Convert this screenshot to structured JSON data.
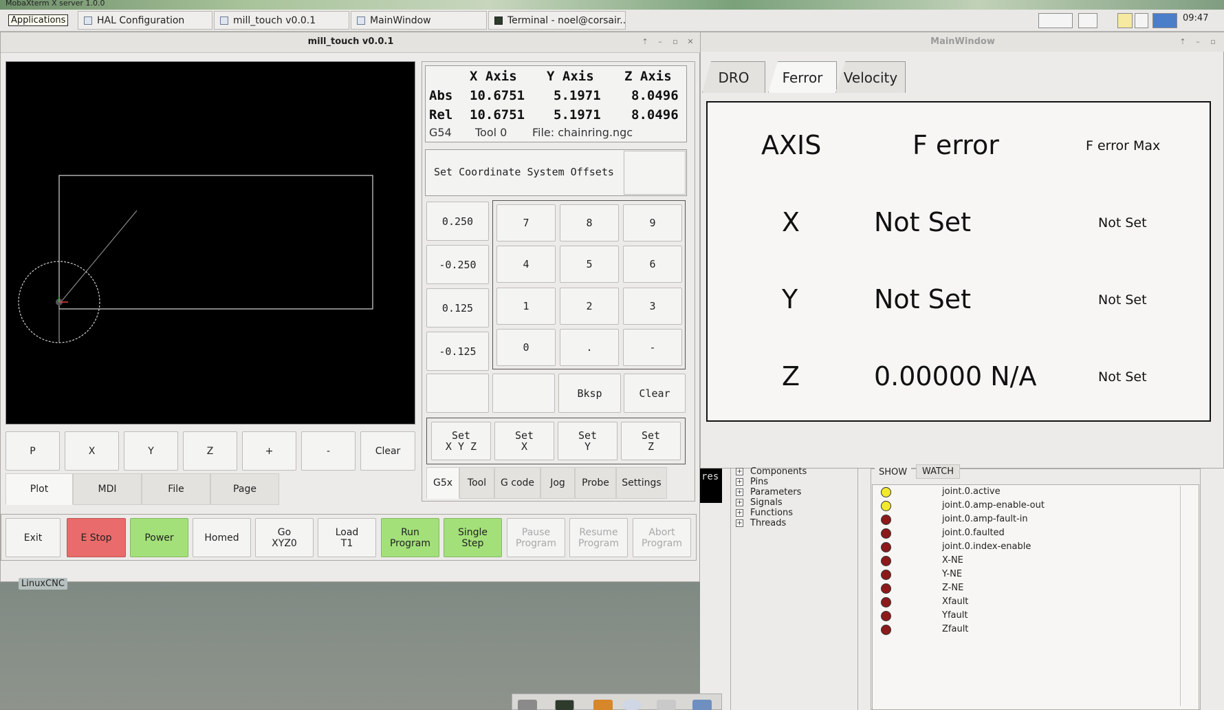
{
  "taskbar": {
    "xserver_label": "MobaXterm X server 1.0.0",
    "apps_label": "Applications",
    "tasks": [
      {
        "label": "HAL Configuration",
        "icon": "window-icon"
      },
      {
        "label": "mill_touch v0.0.1",
        "icon": "window-icon"
      },
      {
        "label": "MainWindow",
        "icon": "window-icon"
      },
      {
        "label": "Terminal - noel@corsair...",
        "icon": "terminal-icon"
      }
    ],
    "clock": "09:47"
  },
  "mill_window": {
    "title": "mill_touch v0.0.1",
    "dro": {
      "headers": [
        "X Axis",
        "Y Axis",
        "Z Axis"
      ],
      "abs_label": "Abs",
      "rel_label": "Rel",
      "abs": [
        "10.6751",
        "5.1971",
        "8.0496"
      ],
      "rel": [
        "10.6751",
        "5.1971",
        "8.0496"
      ],
      "coord_system": "G54",
      "tool": "Tool 0",
      "file": "File: chainring.ngc"
    },
    "offsets_label": "Set Coordinate System Offsets",
    "jog_increments": [
      "0.250",
      "-0.250",
      "0.125",
      "-0.125"
    ],
    "keypad": [
      "7",
      "8",
      "9",
      "4",
      "5",
      "6",
      "1",
      "2",
      "3",
      "0",
      ".",
      "-"
    ],
    "edit_buttons": {
      "backspace": "Bksp",
      "clear": "Clear"
    },
    "set_buttons": [
      "Set\nX Y Z",
      "Set\nX",
      "Set\nY",
      "Set\nZ"
    ],
    "right_tabs": [
      "G5x",
      "Tool",
      "G code",
      "Jog",
      "Probe",
      "Settings"
    ],
    "plot_buttons": [
      "P",
      "X",
      "Y",
      "Z",
      "+",
      "-",
      "Clear"
    ],
    "left_tabs": [
      "Plot",
      "MDI",
      "File",
      "Page"
    ],
    "bottom_buttons": [
      {
        "label": "Exit",
        "style": "normal"
      },
      {
        "label": "E Stop",
        "style": "red"
      },
      {
        "label": "Power",
        "style": "green"
      },
      {
        "label": "Homed",
        "style": "normal"
      },
      {
        "label": "Go\nXYZ0",
        "style": "normal"
      },
      {
        "label": "Load\nT1",
        "style": "normal"
      },
      {
        "label": "Run\nProgram",
        "style": "green"
      },
      {
        "label": "Single\nStep",
        "style": "green"
      },
      {
        "label": "Pause\nProgram",
        "style": "disabled"
      },
      {
        "label": "Resume\nProgram",
        "style": "disabled"
      },
      {
        "label": "Abort\nProgram",
        "style": "disabled"
      }
    ]
  },
  "main_window": {
    "title": "MainWindow",
    "tabs": [
      "DRO",
      "Ferror",
      "Velocity"
    ],
    "ferror": {
      "headers": [
        "AXIS",
        "F error",
        "F error Max"
      ],
      "rows": [
        {
          "axis": "X",
          "ferror": "Not Set",
          "max": "Not Set"
        },
        {
          "axis": "Y",
          "ferror": "Not Set",
          "max": "Not Set"
        },
        {
          "axis": "Z",
          "ferror": "0.00000 N/A",
          "max": "Not Set"
        }
      ]
    }
  },
  "hal": {
    "terminal_text": "res",
    "tree": [
      "Components",
      "Pins",
      "Parameters",
      "Signals",
      "Functions",
      "Threads"
    ],
    "tabs": [
      "SHOW",
      "WATCH"
    ],
    "watch": [
      {
        "name": "joint.0.active",
        "state": "on"
      },
      {
        "name": "joint.0.amp-enable-out",
        "state": "on"
      },
      {
        "name": "joint.0.amp-fault-in",
        "state": "off"
      },
      {
        "name": "joint.0.faulted",
        "state": "off"
      },
      {
        "name": "joint.0.index-enable",
        "state": "off"
      },
      {
        "name": "X-NE",
        "state": "off"
      },
      {
        "name": "Y-NE",
        "state": "off"
      },
      {
        "name": "Z-NE",
        "state": "off"
      },
      {
        "name": "Xfault",
        "state": "off"
      },
      {
        "name": "Yfault",
        "state": "off"
      },
      {
        "name": "Zfault",
        "state": "off"
      }
    ],
    "colors": {
      "led_on": "#f2e92a",
      "led_off": "#8c1a1a"
    }
  },
  "desktop": {
    "linuxcnc_label": "LinuxCNC"
  }
}
